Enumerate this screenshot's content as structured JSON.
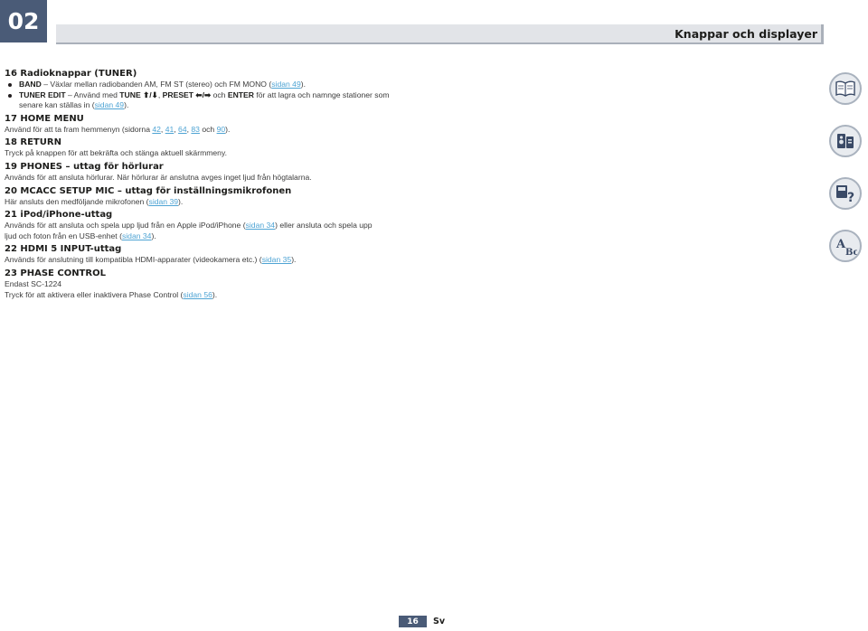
{
  "header": {
    "chapter": "02",
    "title": "Knappar och displayer"
  },
  "sections": [
    {
      "heading": "16   Radioknappar (TUNER)",
      "lines": [
        [
          {
            "t": "BAND",
            "b": true
          },
          {
            "t": " – Växlar mellan radiobanden AM, FM ST (stereo) och FM MONO ("
          },
          {
            "t": "sidan 49",
            "l": true
          },
          {
            "t": ")."
          }
        ],
        [
          {
            "t": "TUNER EDIT",
            "b": true
          },
          {
            "t": " – Använd med "
          },
          {
            "t": "TUNE ⬆/⬇",
            "b": true
          },
          {
            "t": ", "
          },
          {
            "t": "PRESET ⬅/➡",
            "b": true
          },
          {
            "t": " och "
          },
          {
            "t": "ENTER",
            "b": true
          },
          {
            "t": " för att lagra och namnge stationer som"
          }
        ],
        [
          {
            "t": "senare kan ställas in ("
          },
          {
            "t": "sidan 49",
            "l": true
          },
          {
            "t": ")."
          }
        ]
      ],
      "bulleted": true
    },
    {
      "heading": "17   HOME MENU",
      "lines": [
        [
          {
            "t": "Använd för att ta fram hemmenyn (sidorna "
          },
          {
            "t": "42",
            "l": true
          },
          {
            "t": ", "
          },
          {
            "t": "41",
            "l": true
          },
          {
            "t": ", "
          },
          {
            "t": "64",
            "l": true
          },
          {
            "t": ", "
          },
          {
            "t": "83",
            "l": true
          },
          {
            "t": " och "
          },
          {
            "t": "90",
            "l": true
          },
          {
            "t": ")."
          }
        ]
      ]
    },
    {
      "heading": "18   RETURN",
      "lines": [
        [
          {
            "t": "Tryck på knappen för att bekräfta och stänga aktuell skärmmeny."
          }
        ]
      ]
    },
    {
      "heading": "19   PHONES – uttag för hörlurar",
      "lines": [
        [
          {
            "t": "Används för att ansluta hörlurar. När hörlurar är anslutna avges inget ljud från högtalarna."
          }
        ]
      ]
    },
    {
      "heading": "20   MCACC SETUP MIC – uttag för inställningsmikrofonen",
      "lines": [
        [
          {
            "t": "Här ansluts den medföljande mikrofonen ("
          },
          {
            "t": "sidan 39",
            "l": true
          },
          {
            "t": ")."
          }
        ]
      ]
    },
    {
      "heading": "21   iPod/iPhone-uttag",
      "lines": [
        [
          {
            "t": "Används för att ansluta och spela upp ljud från en Apple iPod/iPhone ("
          },
          {
            "t": "sidan 34",
            "l": true
          },
          {
            "t": ") eller ansluta och spela upp"
          }
        ],
        [
          {
            "t": "ljud och foton från en USB-enhet ("
          },
          {
            "t": "sidan 34",
            "l": true
          },
          {
            "t": ")."
          }
        ]
      ]
    },
    {
      "heading": "22   HDMI 5 INPUT-uttag",
      "lines": [
        [
          {
            "t": "Används för anslutning till kompatibla HDMI-apparater (videokamera etc.) ("
          },
          {
            "t": "sidan 35",
            "l": true
          },
          {
            "t": ")."
          }
        ]
      ]
    },
    {
      "heading": "23   PHASE CONTROL",
      "lines": [
        [
          {
            "t": "Endast SC-1224"
          }
        ],
        [
          {
            "t": "Tryck för att aktivera eller inaktivera Phase Control ("
          },
          {
            "t": "sidan 56",
            "l": true
          },
          {
            "t": ")."
          }
        ]
      ]
    }
  ],
  "side_icons": [
    "book-icon",
    "remote-receiver-icon",
    "faq-icon",
    "abc-glossary-icon"
  ],
  "footer": {
    "page": "16",
    "lang": "Sv"
  },
  "colors": {
    "accent": "#4a5b77",
    "link": "#4fa4d4",
    "header_bar": "#e2e4e8"
  }
}
